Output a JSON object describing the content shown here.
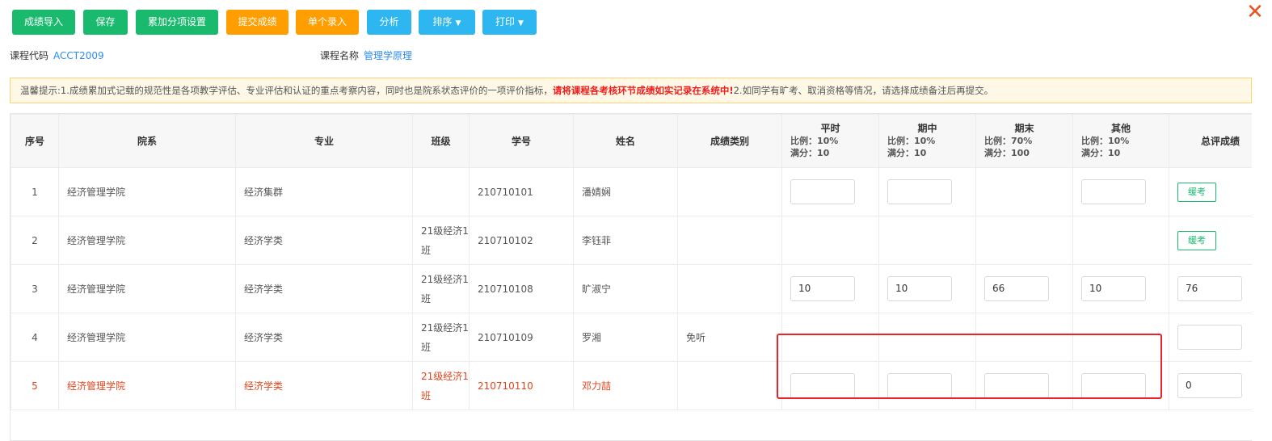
{
  "toolbar": {
    "buttons": [
      {
        "label": "成绩导入"
      },
      {
        "label": "保存"
      },
      {
        "label": "累加分项设置"
      },
      {
        "label": "提交成绩"
      },
      {
        "label": "单个录入"
      },
      {
        "label": "分析"
      },
      {
        "label": "排序"
      },
      {
        "label": "打印"
      }
    ]
  },
  "course": {
    "code_label": "课程代码",
    "code_value": "ACCT2009",
    "name_label": "课程名称",
    "name_value": "管理学原理"
  },
  "notice": {
    "part1": "温馨提示:1.成绩累加式记载的规范性是各项教学评估、专业评估和认证的重点考察内容，同时也是院系状态评价的一项评价指标，",
    "warn": "请将课程各考核环节成绩如实记录在系统中!",
    "part2": "2.如同学有旷考、取消资格等情况，请选择成绩备注后再提交。"
  },
  "table": {
    "headers": {
      "index": "序号",
      "dept": "院系",
      "major": "专业",
      "class": "班级",
      "student_id": "学号",
      "name": "姓名",
      "grade_type": "成绩类别",
      "total": "总评成绩"
    },
    "score_columns": [
      {
        "title": "平时",
        "ratio": "比例：10%",
        "full": "满分：10"
      },
      {
        "title": "期中",
        "ratio": "比例：10%",
        "full": "满分：10"
      },
      {
        "title": "期末",
        "ratio": "比例：70%",
        "full": "满分：100"
      },
      {
        "title": "其他",
        "ratio": "比例：10%",
        "full": "满分：10"
      }
    ],
    "rows": [
      {
        "index": "1",
        "dept": "经济管理学院",
        "major": "经济集群",
        "class": "",
        "student_id": "210710101",
        "name": "潘婧娴",
        "grade_type": "",
        "s1": "",
        "s2": "",
        "s4": "",
        "tag": "缓考"
      },
      {
        "index": "2",
        "dept": "经济管理学院",
        "major": "经济学类",
        "class": "21级经济1班",
        "student_id": "210710102",
        "name": "李钰菲",
        "grade_type": "",
        "tag": "缓考"
      },
      {
        "index": "3",
        "dept": "经济管理学院",
        "major": "经济学类",
        "class": "21级经济1班",
        "student_id": "210710108",
        "name": "旷淑宁",
        "grade_type": "",
        "s1": "10",
        "s2": "10",
        "s3": "66",
        "s4": "10",
        "total": "76"
      },
      {
        "index": "4",
        "dept": "经济管理学院",
        "major": "经济学类",
        "class": "21级经济1班",
        "student_id": "210710109",
        "name": "罗湘",
        "grade_type": "免听",
        "total": ""
      },
      {
        "index": "5",
        "dept": "经济管理学院",
        "major": "经济学类",
        "class": "21级经济1班",
        "student_id": "210710110",
        "name": "邓力喆",
        "grade_type": "",
        "s1": "",
        "s2": "",
        "s3": "",
        "s4": "",
        "total": "0"
      }
    ]
  },
  "colors": {
    "green": "#1aba6e",
    "orange": "#ff9e00",
    "blue": "#2eb6f0",
    "highlight_row": "#e0451c",
    "annotation_box": "#e8242a"
  },
  "icons": {
    "close": "close-icon",
    "dropdown": "chevron-down-icon"
  }
}
